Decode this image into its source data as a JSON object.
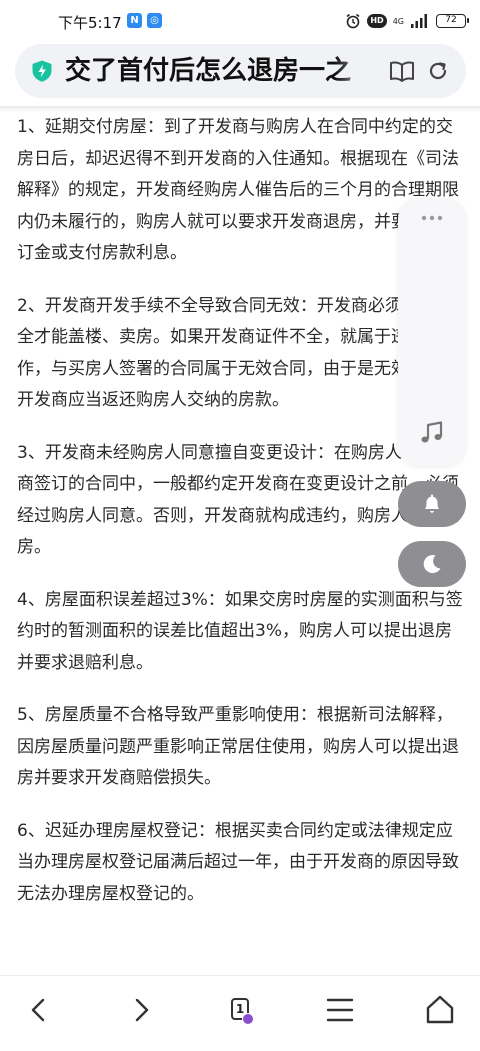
{
  "status_bar": {
    "time": "下午5:17",
    "app_badges": [
      "N",
      "◎"
    ],
    "hd": "HD",
    "network": "4G",
    "battery": "72"
  },
  "url_bar": {
    "title": "交了首付后怎么退房一之"
  },
  "article": {
    "paragraphs": [
      "1、延期交付房屋：到了开发商与购房人在合同中约定的交房日后，却迟迟得不到开发商的入住通知。根据现在《司法解释》的规定，开发商经购房人催告后的三个月的合理期限内仍未履行的，购房人就可以要求开发商退房，并要求返还订金或支付房款利息。",
      "2、开发商开发手续不全导致合同无效：开发商必须证件齐全才能盖楼、卖房。如果开发商证件不全，就属于违法操作，与买房人签署的合同属于无效合同，由于是无效合同，开发商应当返还购房人交纳的房款。",
      "3、开发商未经购房人同意擅自变更设计：在购房人与开发商签订的合同中，一般都约定开发商在变更设计之前，必须经过购房人同意。否则，开发商就构成违约，购房人有权退房。",
      "4、房屋面积误差超过3%：如果交房时房屋的实测面积与签约时的暂测面积的误差比值超出3%，购房人可以提出退房并要求退赔利息。",
      "5、房屋质量不合格导致严重影响使用：根据新司法解释，因房屋质量问题严重影响正常居住使用，购房人可以提出退房并要求开发商赔偿损失。",
      "6、迟延办理房屋权登记：根据买卖合同约定或法律规定应当办理房屋权登记届满后超过一年，由于开发商的原因导致无法办理房屋权登记的。"
    ]
  },
  "bottom_nav": {
    "tab_count": "1"
  },
  "colors": {
    "shield_green": "#19c3a0",
    "float_button_gray": "#8e8e93",
    "tab_avatar_purple": "#8a4fd0"
  },
  "icons": [
    "alarm-icon",
    "signal-icon",
    "battery-icon",
    "shield-icon",
    "reader-mode-icon",
    "refresh-icon",
    "more-icon",
    "music-icon",
    "bell-icon",
    "moon-icon",
    "back-icon",
    "forward-icon",
    "menu-icon",
    "home-icon"
  ]
}
